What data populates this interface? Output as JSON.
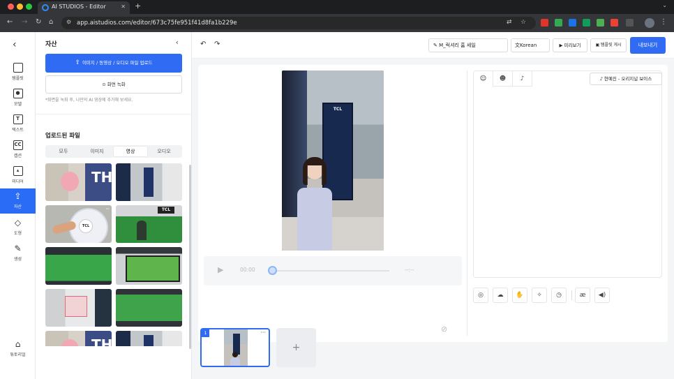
{
  "browser": {
    "tab_title": "AI STUDIOS - Editor",
    "url": "app.aistudios.com/editor/673c75fe951f41d8fa1b229e",
    "new_tab": "+",
    "tab_close": "✕",
    "menu": "⌄"
  },
  "sidebar": {
    "back": "‹",
    "items": [
      {
        "label": "템플릿",
        "icon": "template-icon",
        "glyph": "▦"
      },
      {
        "label": "모델",
        "icon": "model-icon",
        "glyph": "☗"
      },
      {
        "label": "텍스트",
        "icon": "text-icon",
        "glyph": "T"
      },
      {
        "label": "캡션",
        "icon": "caption-icon",
        "glyph": "CC"
      },
      {
        "label": "미디어",
        "icon": "media-icon",
        "glyph": "▲"
      },
      {
        "label": "자산",
        "icon": "asset-upload-icon",
        "glyph": "⇪",
        "active": true
      },
      {
        "label": "도형",
        "icon": "shapes-icon",
        "glyph": "◇"
      },
      {
        "label": "생성",
        "icon": "generate-icon",
        "glyph": "✎"
      },
      {
        "label": "튜토리얼",
        "icon": "tutorial-icon",
        "glyph": "🎓"
      }
    ]
  },
  "panel": {
    "title": "자산",
    "close": "‹",
    "upload_label": "이미지 / 동영상 / 오디오 파일 업로드",
    "record_label": "화면 녹화",
    "hint": "*화면을 녹화 후, 나만의 AI 영상에 추가해 보세요.",
    "files_title": "업로드된 파일",
    "filters": [
      "모두",
      "이미지",
      "영상",
      "오디오"
    ],
    "active_filter": "영상",
    "more": "···"
  },
  "topbar": {
    "undo": "↶",
    "redo": "↷",
    "project_name": "M_럭셔리 홈 세일",
    "language": "Korean",
    "preview": "미리보기",
    "template_post": "템플릿 게시",
    "export": "내보내기"
  },
  "player": {
    "current": "00:00",
    "total": "--:--"
  },
  "script": {
    "voice": "현예진 - 오리지널 보이스"
  },
  "scenes": [
    {
      "number": "1"
    }
  ],
  "add_scene": "+",
  "colors": {
    "accent": "#2f6cf3",
    "active_sidebar": "#2b6cf6"
  }
}
